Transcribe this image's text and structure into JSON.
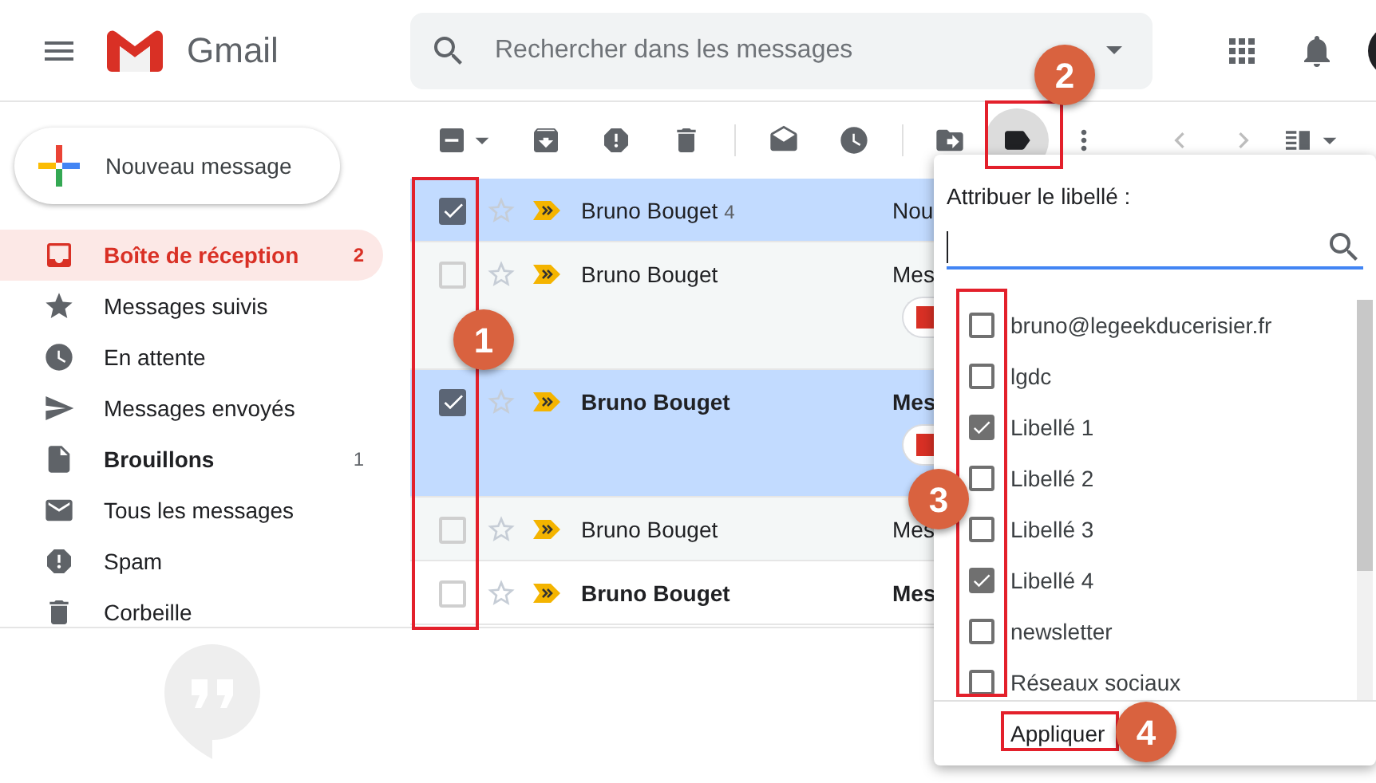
{
  "header": {
    "logo_text": "Gmail",
    "search": {
      "placeholder": "Rechercher dans les messages"
    }
  },
  "compose": {
    "label": "Nouveau message"
  },
  "nav": [
    {
      "kind": "inbox",
      "label": "Boîte de réception",
      "count": "2",
      "selected": true,
      "bold": true
    },
    {
      "kind": "starred",
      "label": "Messages suivis",
      "selected": false,
      "bold": false
    },
    {
      "kind": "snoozed",
      "label": "En attente",
      "selected": false,
      "bold": false
    },
    {
      "kind": "sent",
      "label": "Messages envoyés",
      "selected": false,
      "bold": false
    },
    {
      "kind": "drafts",
      "label": "Brouillons",
      "count": "1",
      "selected": false,
      "bold": true
    },
    {
      "kind": "all",
      "label": "Tous les messages",
      "selected": false,
      "bold": false
    },
    {
      "kind": "spam",
      "label": "Spam",
      "selected": false,
      "bold": false
    },
    {
      "kind": "trash",
      "label": "Corbeille",
      "selected": false,
      "bold": false
    }
  ],
  "toolbar": {
    "select_all": {
      "indeterminate": true
    },
    "label_button": {
      "selected": true
    }
  },
  "emails": [
    {
      "sender": "Bruno Bouget",
      "thread_count": "4",
      "subject": "Nou",
      "checked": true,
      "unread": false,
      "attachment": false
    },
    {
      "sender": "Bruno Bouget",
      "subject": "Mes",
      "checked": false,
      "unread": false,
      "attachment": true
    },
    {
      "sender": "Bruno Bouget",
      "subject": "Mes",
      "checked": true,
      "unread": true,
      "attachment": true
    },
    {
      "sender": "Bruno Bouget",
      "subject": "Mes",
      "checked": false,
      "unread": false,
      "attachment": false
    },
    {
      "sender": "Bruno Bouget",
      "subject": "Mes",
      "checked": false,
      "unread": true,
      "attachment": false
    }
  ],
  "label_menu": {
    "title": "Attribuer le libellé :",
    "labels": [
      {
        "name": "bruno@legeekducerisier.fr",
        "checked": false
      },
      {
        "name": "lgdc",
        "checked": false
      },
      {
        "name": "Libellé 1",
        "checked": true
      },
      {
        "name": "Libellé 2",
        "checked": false
      },
      {
        "name": "Libellé 3",
        "checked": false
      },
      {
        "name": "Libellé 4",
        "checked": true
      },
      {
        "name": "newsletter",
        "checked": false
      },
      {
        "name": "Réseaux sociaux",
        "checked": false
      }
    ],
    "apply": "Appliquer"
  },
  "annotations": [
    {
      "label": "1"
    },
    {
      "label": "2"
    },
    {
      "label": "3"
    },
    {
      "label": "4"
    }
  ]
}
